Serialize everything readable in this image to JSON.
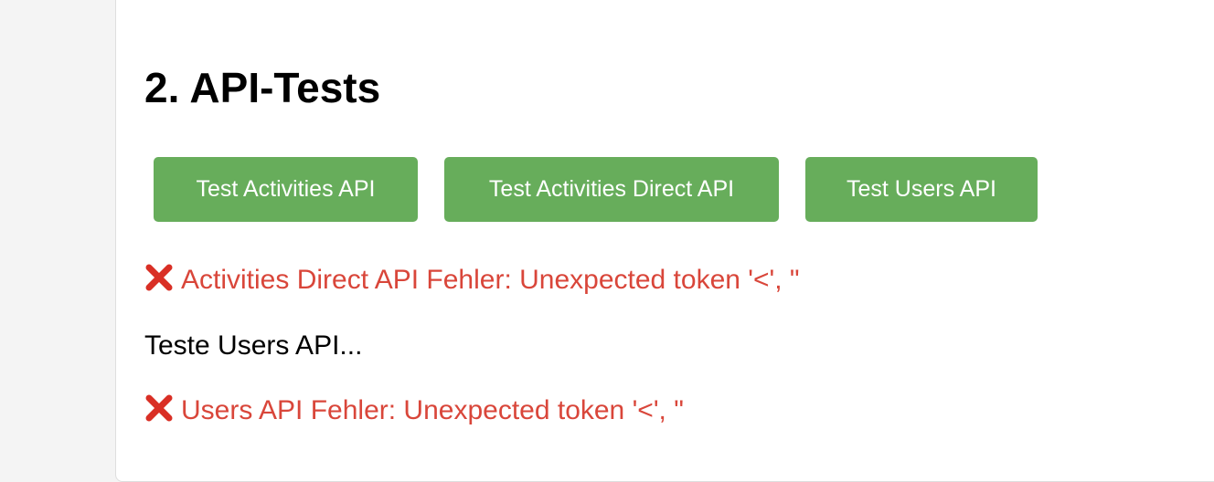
{
  "section": {
    "title": "2. API-Tests"
  },
  "buttons": {
    "activities": "Test Activities API",
    "activities_direct": "Test Activities Direct API",
    "users": "Test Users API"
  },
  "colors": {
    "button_bg": "#67ad5b",
    "error_text": "#d9463a",
    "error_icon": "#d92f25"
  },
  "log": [
    {
      "type": "error",
      "icon": "cross-mark-icon",
      "text": "Activities Direct API Fehler: Unexpected token '<', \""
    },
    {
      "type": "info",
      "text": "Teste Users API..."
    },
    {
      "type": "error",
      "icon": "cross-mark-icon",
      "text": "Users API Fehler: Unexpected token '<', \""
    }
  ]
}
